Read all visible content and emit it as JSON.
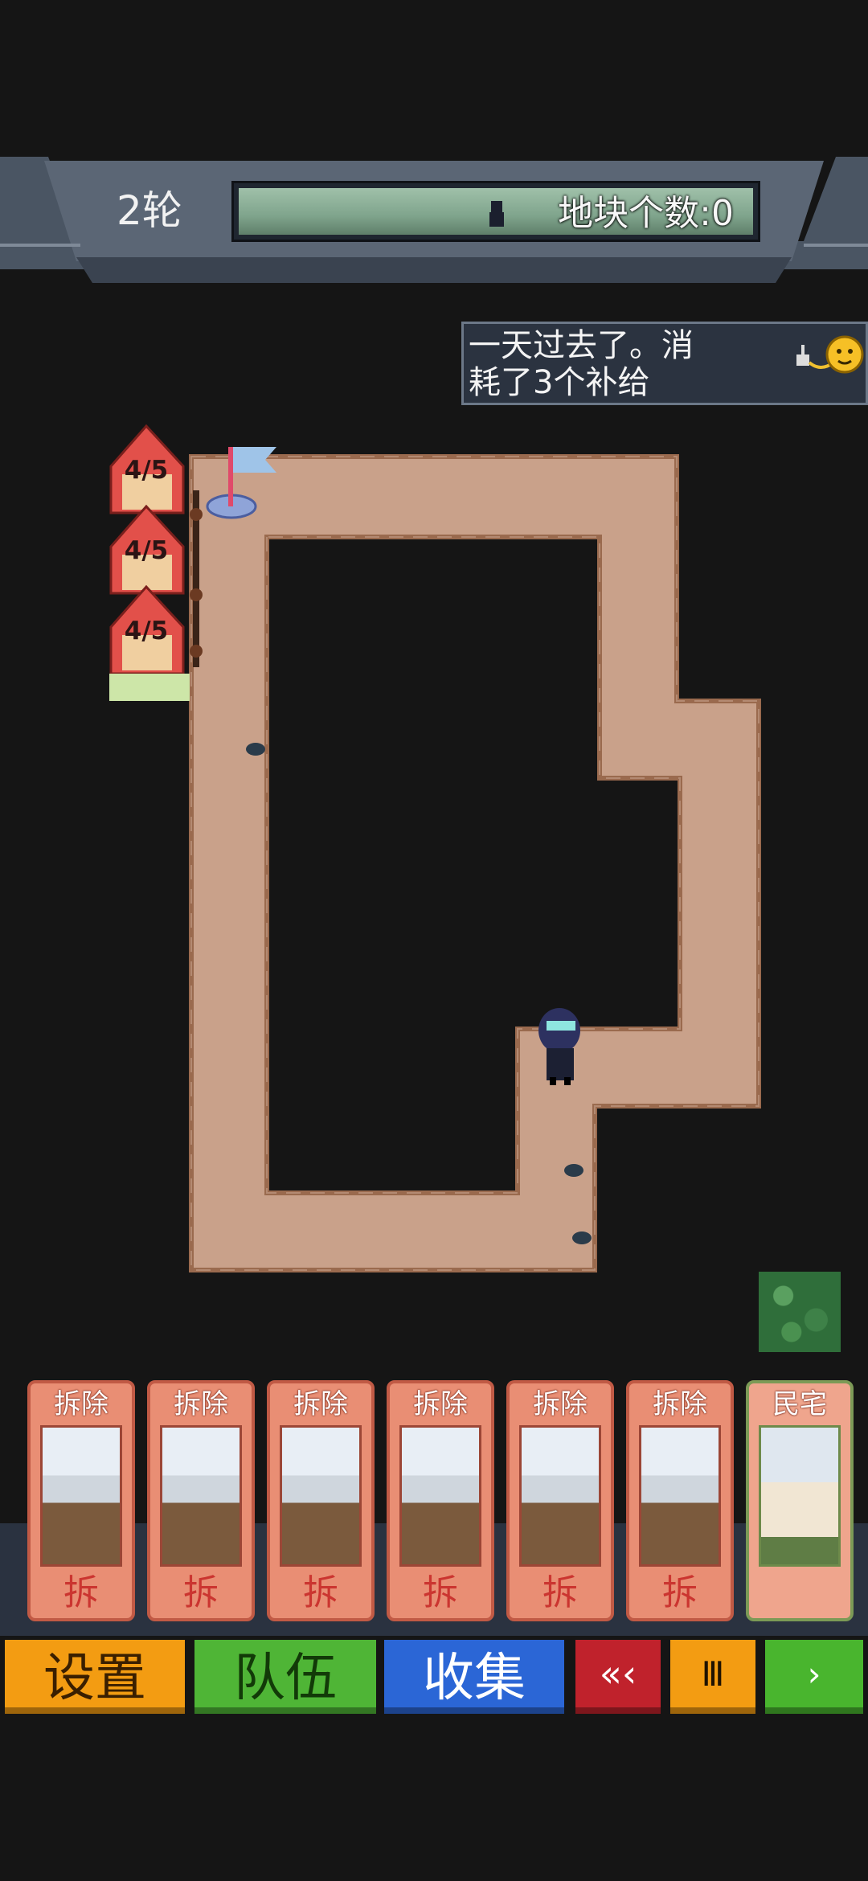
{
  "hud": {
    "round_label": "2轮",
    "progress_label": "地块个数:0",
    "progress_fraction": 0.0
  },
  "message": {
    "text_line1": "一天过去了。消",
    "text_line2": "耗了3个补给",
    "icon": "supply-face-icon"
  },
  "houses": [
    {
      "counter": "4/5"
    },
    {
      "counter": "4/5"
    },
    {
      "counter": "4/5"
    }
  ],
  "cards": [
    {
      "title": "拆除",
      "glyph": "拆",
      "type": "demolish"
    },
    {
      "title": "拆除",
      "glyph": "拆",
      "type": "demolish"
    },
    {
      "title": "拆除",
      "glyph": "拆",
      "type": "demolish"
    },
    {
      "title": "拆除",
      "glyph": "拆",
      "type": "demolish"
    },
    {
      "title": "拆除",
      "glyph": "拆",
      "type": "demolish"
    },
    {
      "title": "拆除",
      "glyph": "拆",
      "type": "demolish"
    },
    {
      "title": "民宅",
      "glyph": "",
      "type": "house"
    }
  ],
  "buttons": {
    "settings": "设置",
    "team": "队伍",
    "collect": "收集",
    "back": "«‹",
    "pause": "Ⅲ",
    "play": "›"
  },
  "colors": {
    "path": "#c9a18a",
    "path_edge": "#9a6a4e",
    "background": "#151515",
    "settings_button": "#f39c12",
    "team_button": "#4fb536",
    "collect_button": "#2b66d6",
    "back_button": "#c0222c"
  }
}
